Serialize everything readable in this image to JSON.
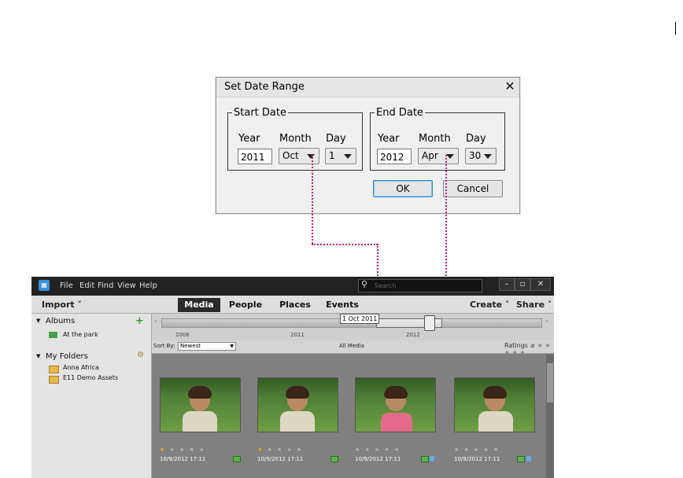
{
  "dialog": {
    "title": "Set Date Range",
    "close_glyph": "✕",
    "start": {
      "legend": "Start Date",
      "year_label": "Year",
      "month_label": "Month",
      "day_label": "Day",
      "year": "2011",
      "month": "Oct",
      "day": "1"
    },
    "end": {
      "legend": "End Date",
      "year_label": "Year",
      "month_label": "Month",
      "day_label": "Day",
      "year": "2012",
      "month": "Apr",
      "day": "30"
    },
    "ok_label": "OK",
    "cancel_label": "Cancel"
  },
  "app": {
    "menus": [
      "File",
      "Edit",
      "Find",
      "View",
      "Help"
    ],
    "search_placeholder": "Search",
    "window_buttons": [
      "–",
      "▫",
      "✕"
    ],
    "toolbar": {
      "import_label": "Import",
      "tabs": [
        "Media",
        "People",
        "Places",
        "Events"
      ],
      "active_tab": "Media",
      "create_label": "Create",
      "share_label": "Share"
    },
    "sidebar": {
      "albums_header": "Albums",
      "albums": [
        "At the park"
      ],
      "folders_header": "My Folders",
      "folders": [
        "Anna Africa",
        "E11 Demo Assets"
      ]
    },
    "timeline": {
      "years": [
        "2006",
        "2011",
        "2012"
      ],
      "tooltip": "1 Oct 2011"
    },
    "sortbar": {
      "sort_label": "Sort By:",
      "sort_value": "Newest",
      "all_media_label": "All Media",
      "ratings_label": "Ratings",
      "ratings_operator": "≥",
      "ratings_stars": "★ ★ ★ ★ ★"
    },
    "photos": [
      {
        "date": "10/9/2012 17:11",
        "stars": "★ ★ ★ ★ ★"
      },
      {
        "date": "10/9/2012 17:11",
        "stars": "★ ★ ★ ★ ★"
      },
      {
        "date": "10/9/2012 17:11",
        "stars": "★ ★ ★ ★ ★"
      },
      {
        "date": "10/9/2012 17:11",
        "stars": "★ ★ ★ ★ ★"
      }
    ]
  },
  "colors": {
    "connector": "#c0246e",
    "menubar": "#222222",
    "active_tab": "#2a2a2a"
  }
}
